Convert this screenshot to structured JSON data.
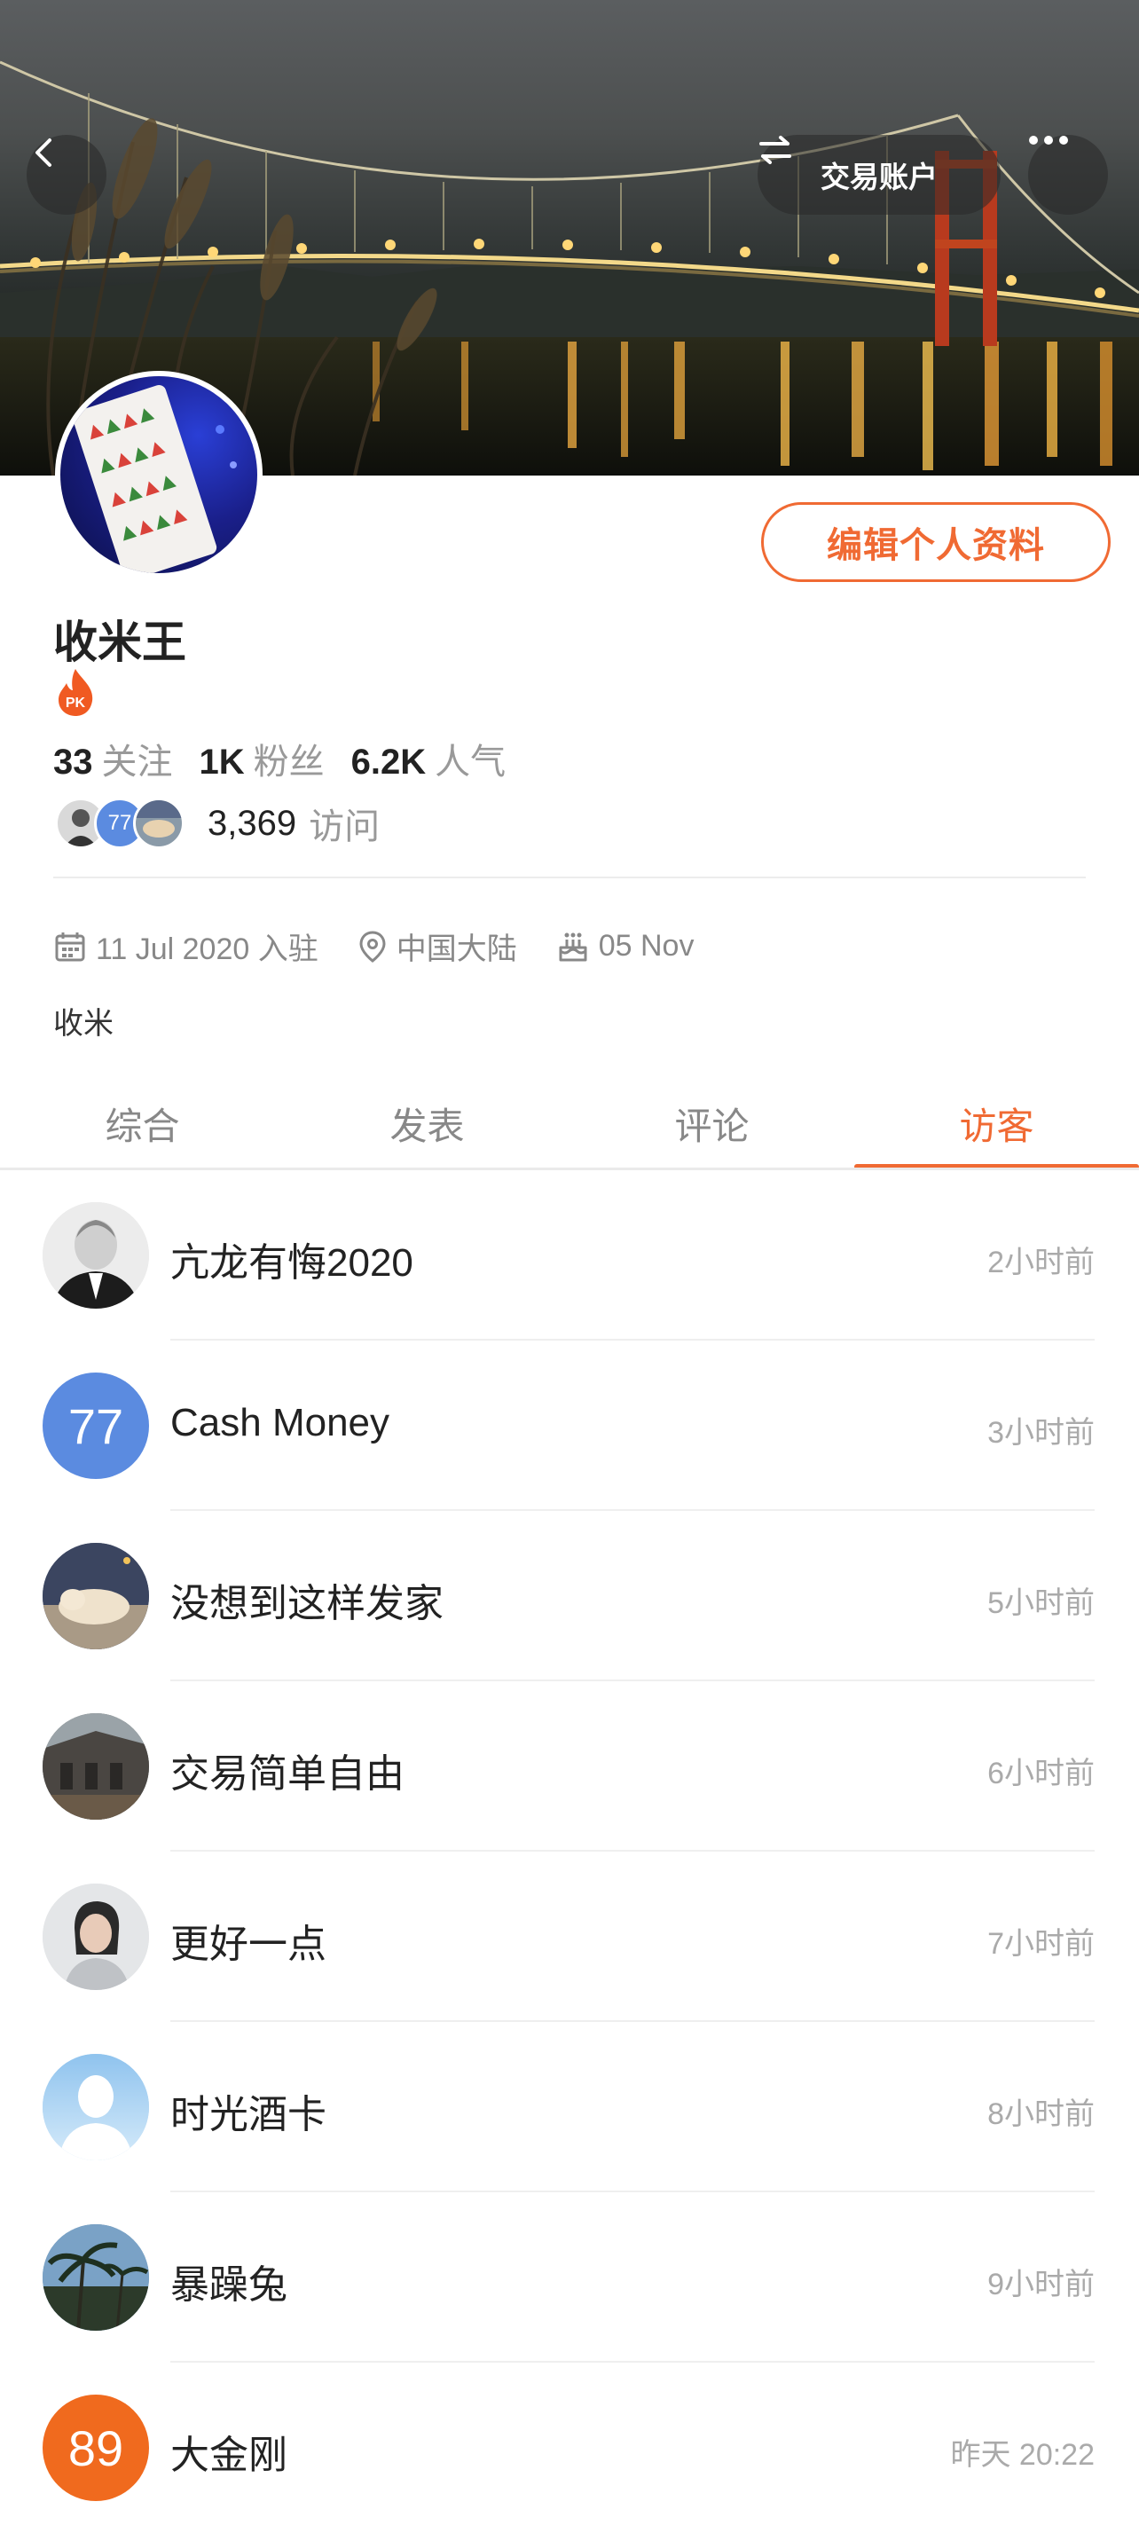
{
  "header": {
    "switch_label": "交易账户",
    "edit_label": "编辑个人资料"
  },
  "profile": {
    "username": "收米王",
    "badge_text": "PK",
    "stats": [
      {
        "value": "33",
        "label": "关注"
      },
      {
        "value": "1K",
        "label": "粉丝"
      },
      {
        "value": "6.2K",
        "label": "人气"
      }
    ],
    "visit_avatar_number": "77",
    "visit_count": "3,369",
    "visit_label": "访问",
    "joined": "11 Jul 2020 入驻",
    "location": "中国大陆",
    "birthday": "05 Nov",
    "bio": "收米"
  },
  "tabs": [
    {
      "label": "综合"
    },
    {
      "label": "发表"
    },
    {
      "label": "评论"
    },
    {
      "label": "访客",
      "active": true
    }
  ],
  "visitors": [
    {
      "name": "亢龙有悔2020",
      "time": "2小时前",
      "avatar_text": ""
    },
    {
      "name": "Cash Money",
      "time": "3小时前",
      "avatar_text": "77"
    },
    {
      "name": "没想到这样发家",
      "time": "5小时前",
      "avatar_text": ""
    },
    {
      "name": "交易简单自由",
      "time": "6小时前",
      "avatar_text": ""
    },
    {
      "name": "更好一点",
      "time": "7小时前",
      "avatar_text": ""
    },
    {
      "name": "时光酒卡",
      "time": "8小时前",
      "avatar_text": ""
    },
    {
      "name": "暴躁兔",
      "time": "9小时前",
      "avatar_text": ""
    },
    {
      "name": "大金刚",
      "time": "昨天 20:22",
      "avatar_text": "89"
    }
  ],
  "colors": {
    "accent": "#f06a33",
    "avatar_blue": "#5b8be0",
    "avatar_orange": "#f06a1e"
  }
}
